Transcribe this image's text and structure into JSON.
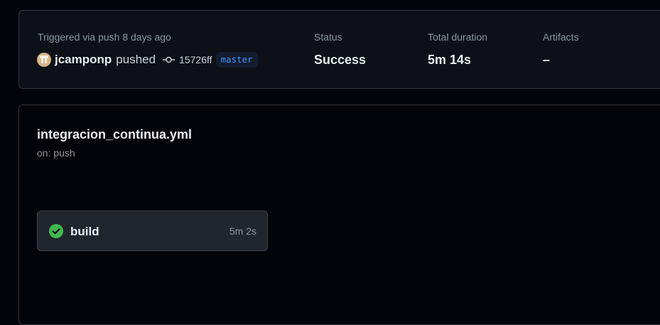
{
  "summary": {
    "trigger_text": "Triggered via push 8 days ago",
    "actor": "jcamponp",
    "action": "pushed",
    "commit_sha": "15726ff",
    "branch": "master",
    "status_label": "Status",
    "status_value": "Success",
    "duration_label": "Total duration",
    "duration_value": "5m 14s",
    "artifacts_label": "Artifacts",
    "artifacts_value": "–"
  },
  "workflow": {
    "file_name": "integracion_continua.yml",
    "trigger": "on: push",
    "jobs": [
      {
        "name": "build",
        "duration": "5m 2s",
        "status": "success",
        "status_icon": "check-circle-fill-icon"
      }
    ]
  },
  "colors": {
    "success": "#3fb950",
    "branch_text": "#4493f8",
    "branch_bg": "#121d2f",
    "muted_text": "#8d96a0"
  }
}
